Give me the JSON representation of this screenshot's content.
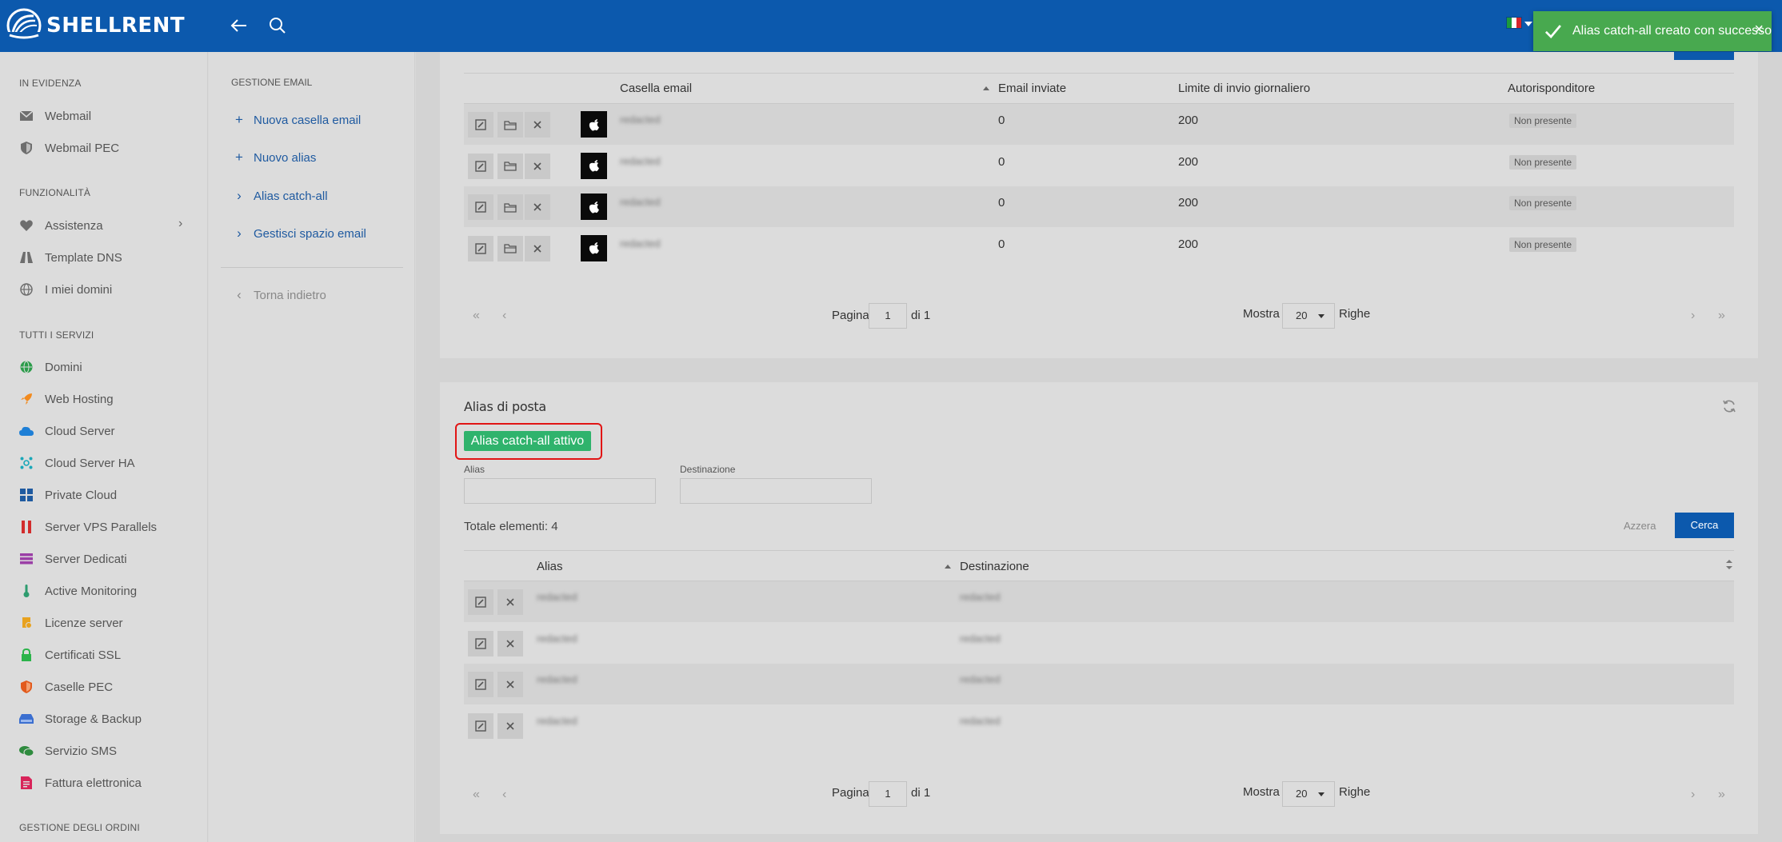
{
  "brand": {
    "name": "SHELLRENT"
  },
  "toast": {
    "message": "Alias catch-all creato con successo",
    "close": "×"
  },
  "sidebar": {
    "sections": [
      {
        "title": "IN EVIDENZA",
        "items": [
          {
            "label": "Webmail",
            "icon": "mail-icon"
          },
          {
            "label": "Webmail PEC",
            "icon": "shield-icon"
          }
        ]
      },
      {
        "title": "FUNZIONALITÀ",
        "items": [
          {
            "label": "Assistenza",
            "icon": "heart-icon"
          },
          {
            "label": "Template DNS",
            "icon": "road-icon"
          },
          {
            "label": "I miei domini",
            "icon": "globe-icon"
          }
        ]
      },
      {
        "title": "TUTTI I SERVIZI",
        "items": [
          {
            "label": "Domini",
            "icon": "globe-icon"
          },
          {
            "label": "Web Hosting",
            "icon": "rocket-icon"
          },
          {
            "label": "Cloud Server",
            "icon": "cloud-icon"
          },
          {
            "label": "Cloud Server HA",
            "icon": "network-icon"
          },
          {
            "label": "Private Cloud",
            "icon": "grid-icon"
          },
          {
            "label": "Server VPS Parallels",
            "icon": "parallels-icon"
          },
          {
            "label": "Server Dedicati",
            "icon": "server-icon"
          },
          {
            "label": "Active Monitoring",
            "icon": "thermometer-icon"
          },
          {
            "label": "Licenze server",
            "icon": "license-icon"
          },
          {
            "label": "Certificati SSL",
            "icon": "lock-icon"
          },
          {
            "label": "Caselle PEC",
            "icon": "shield-icon"
          },
          {
            "label": "Storage & Backup",
            "icon": "storage-icon"
          },
          {
            "label": "Servizio SMS",
            "icon": "chat-icon"
          },
          {
            "label": "Fattura elettronica",
            "icon": "invoice-icon"
          }
        ]
      },
      {
        "title": "GESTIONE DEGLI ORDINI",
        "items": []
      }
    ]
  },
  "submenu": {
    "title": "GESTIONE EMAIL",
    "items": [
      {
        "label": "Nuova casella email",
        "marker": "+"
      },
      {
        "label": "Nuovo alias",
        "marker": "+"
      },
      {
        "label": "Alias catch-all",
        "marker": "›"
      },
      {
        "label": "Gestisci spazio email",
        "marker": "›"
      }
    ],
    "back": {
      "label": "Torna indietro",
      "marker": "‹"
    }
  },
  "mailboxes": {
    "columns": {
      "email": "Casella email",
      "sent": "Email inviate",
      "limit": "Limite di invio giornaliero",
      "autoresponder": "Autorisponditore"
    },
    "rows": [
      {
        "email": "redacted",
        "sent": "0",
        "limit": "200",
        "autoresponder": "Non presente"
      },
      {
        "email": "redacted",
        "sent": "0",
        "limit": "200",
        "autoresponder": "Non presente"
      },
      {
        "email": "redacted",
        "sent": "0",
        "limit": "200",
        "autoresponder": "Non presente"
      },
      {
        "email": "redacted",
        "sent": "0",
        "limit": "200",
        "autoresponder": "Non presente"
      }
    ],
    "pager": {
      "page_label": "Pagina",
      "page": "1",
      "of_label": "di 1",
      "show_label": "Mostra",
      "per_page": "20",
      "rows_label": "Righe"
    }
  },
  "aliases": {
    "title": "Alias di posta",
    "catchall_badge": "Alias catch-all attivo",
    "filters": {
      "alias_label": "Alias",
      "destination_label": "Destinazione"
    },
    "total": "Totale elementi: 4",
    "reset": "Azzera",
    "search": "Cerca",
    "columns": {
      "alias": "Alias",
      "destination": "Destinazione"
    },
    "rows": [
      {
        "alias": "redacted",
        "destination": "redacted"
      },
      {
        "alias": "redacted",
        "destination": "redacted"
      },
      {
        "alias": "redacted",
        "destination": "redacted"
      },
      {
        "alias": "redacted",
        "destination": "redacted"
      }
    ],
    "pager": {
      "page_label": "Pagina",
      "page": "1",
      "of_label": "di 1",
      "show_label": "Mostra",
      "per_page": "20",
      "rows_label": "Righe"
    }
  },
  "colors": {
    "primary": "#0c59ad",
    "success": "#48a94f",
    "badge_green": "#2fb36c",
    "highlight": "#e11515"
  }
}
